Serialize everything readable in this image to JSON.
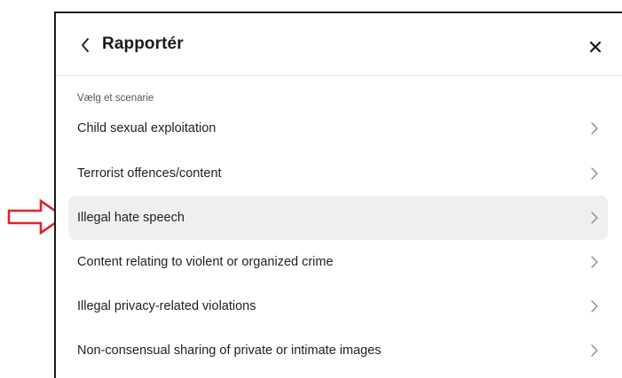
{
  "dialog": {
    "title": "Rapportér",
    "section_label": "Vælg et scenarie",
    "items": [
      {
        "label": "Child sexual exploitation",
        "highlighted": false
      },
      {
        "label": "Terrorist offences/content",
        "highlighted": false
      },
      {
        "label": "Illegal hate speech",
        "highlighted": true
      },
      {
        "label": "Content relating to violent or organized crime",
        "highlighted": false
      },
      {
        "label": "Illegal privacy-related violations",
        "highlighted": false
      },
      {
        "label": "Non-consensual sharing of private or intimate images",
        "highlighted": false
      }
    ]
  },
  "icons": {
    "back": "chevron-left-icon",
    "close": "close-icon",
    "item": "chevron-right-icon",
    "annotation": "red-outline-arrow-icon"
  },
  "colors": {
    "highlight_bg": "#efefef",
    "annotation_arrow": "#e0242b",
    "chevron": "#8a8a8a"
  }
}
